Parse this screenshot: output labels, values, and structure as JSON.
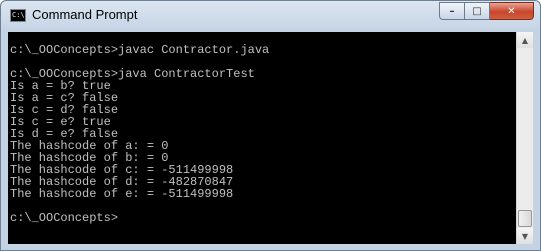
{
  "window": {
    "title": "Command Prompt",
    "icon_text": "C:\\",
    "controls": {
      "minimize": "–",
      "maximize": "□",
      "close": "✕"
    }
  },
  "console": {
    "lines": [
      "",
      "c:\\_OOConcepts>javac Contractor.java",
      "",
      "c:\\_OOConcepts>java ContractorTest",
      "Is a = b? true",
      "Is a = c? false",
      "Is c = d? false",
      "Is c = e? true",
      "Is d = e? false",
      "The hashcode of a: = 0",
      "The hashcode of b: = 0",
      "The hashcode of c: = -511499998",
      "The hashcode of d: = -482870847",
      "The hashcode of e: = -511499998",
      "",
      "c:\\_OOConcepts>"
    ]
  },
  "scrollbar": {
    "up_arrow": "▲",
    "down_arrow": "▼"
  },
  "colors": {
    "console_bg": "#000000",
    "console_text": "#c0c0c0",
    "close_button": "#c9452d"
  }
}
